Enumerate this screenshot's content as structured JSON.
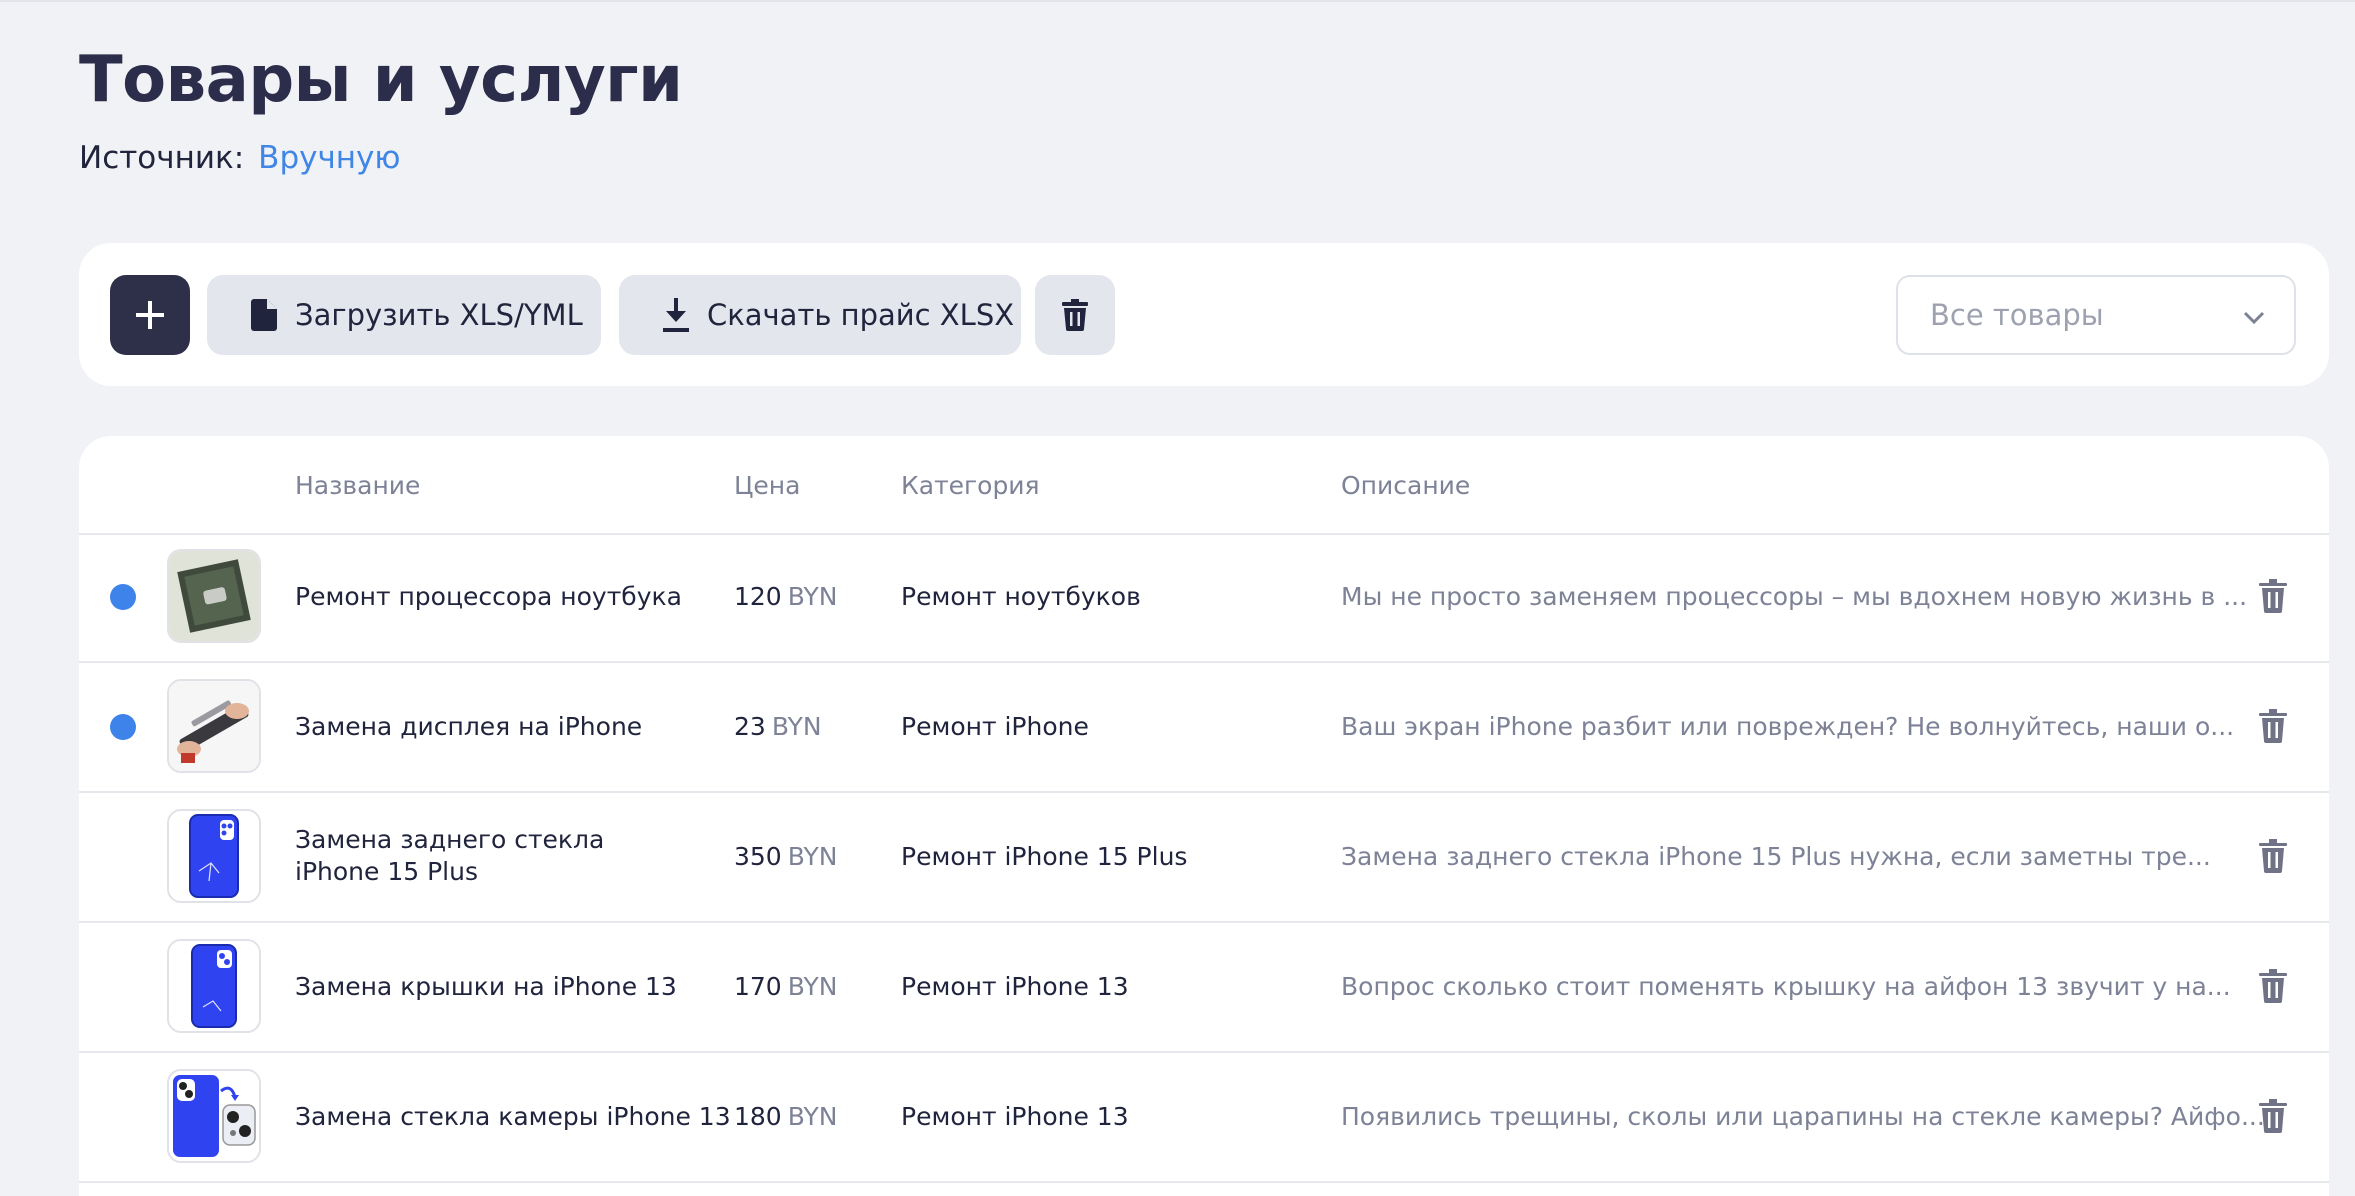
{
  "page": {
    "title": "Товары и услуги",
    "source_label": "Источник:",
    "source_value": "Вручную"
  },
  "toolbar": {
    "add_icon": "plus-icon",
    "upload_label": "Загрузить XLS/YML",
    "upload_icon": "file-icon",
    "download_label": "Скачать прайс XLSX",
    "download_icon": "download-icon",
    "delete_icon": "trash-icon",
    "filter_value": "Все товары",
    "filter_icon": "chevron-down-icon"
  },
  "table": {
    "columns": {
      "name": "Название",
      "price": "Цена",
      "category": "Категория",
      "description": "Описание"
    },
    "rows": [
      {
        "selected": true,
        "thumb": "processor-chip",
        "name": "Ремонт процессора ноутбука",
        "price": "120",
        "currency": "BYN",
        "category": "Ремонт ноутбуков",
        "description": "Мы не просто заменяем процессоры – мы вдохнем новую жизнь в ..."
      },
      {
        "selected": true,
        "thumb": "iphone-display-repair",
        "name": "Замена дисплея на iPhone",
        "price": "23",
        "currency": "BYN",
        "category": "Ремонт iPhone",
        "description": "Ваш экран iPhone разбит или поврежден? Не волнуйтесь, наши о..."
      },
      {
        "selected": false,
        "thumb": "iphone-back-glass",
        "name": "Замена заднего стекла iPhone 15 Plus",
        "price": "350",
        "currency": "BYN",
        "category": "Ремонт iPhone 15 Plus",
        "description": "Замена заднего стекла iPhone 15 Plus нужна, если заметны тре..."
      },
      {
        "selected": false,
        "thumb": "iphone-back-cover",
        "name": "Замена крышки на iPhone 13",
        "price": "170",
        "currency": "BYN",
        "category": "Ремонт iPhone 13",
        "description": "Вопрос сколько стоит поменять крышку на айфон 13 звучит у на..."
      },
      {
        "selected": false,
        "thumb": "iphone-camera-glass",
        "name": "Замена стекла камеры iPhone 13",
        "price": "180",
        "currency": "BYN",
        "category": "Ремонт iPhone 13",
        "description": "Появились трещины, сколы или царапины на стекле камеры? Айфо..."
      }
    ]
  },
  "colors": {
    "accent": "#3f86e6",
    "dark_button": "#2d3048",
    "selected_dot": "#3d83ea",
    "background": "#f1f2f6"
  }
}
